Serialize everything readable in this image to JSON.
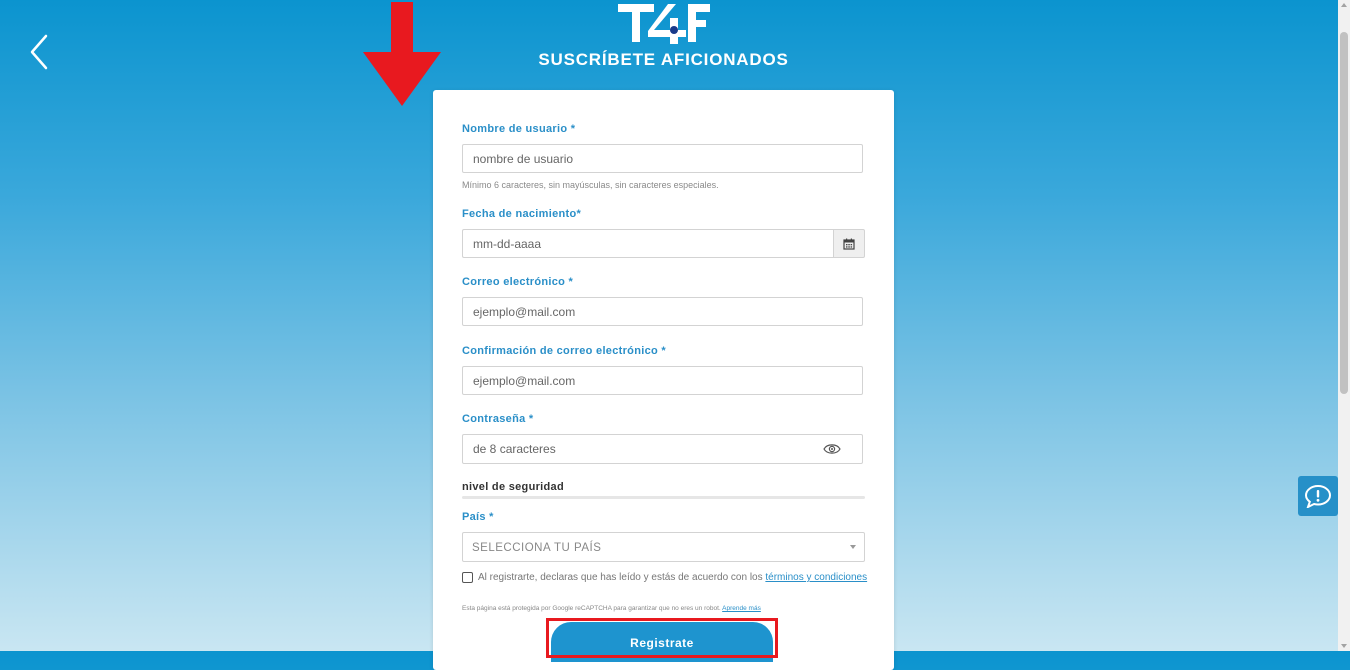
{
  "header": {
    "title": "SUSCRÍBETE AFICIONADOS",
    "logo_text": "T4F"
  },
  "form": {
    "username": {
      "label": "Nombre de usuario *",
      "placeholder": "nombre de usuario",
      "hint": "Mínimo 6 caracteres, sin mayúsculas, sin caracteres especiales."
    },
    "birthdate": {
      "label": "Fecha de nacimiento*",
      "placeholder": "mm-dd-aaaa"
    },
    "email": {
      "label": "Correo electrónico *",
      "placeholder": "ejemplo@mail.com"
    },
    "email_confirm": {
      "label": "Confirmación de correo electrónico *",
      "placeholder": "ejemplo@mail.com"
    },
    "password": {
      "label": "Contraseña *",
      "placeholder": "de 8 caracteres"
    },
    "strength_label": "nivel de seguridad",
    "country": {
      "label": "País *",
      "selected": "SELECCIONA TU PAÍS"
    },
    "terms_text": "Al registrarte, declaras que has leído y estás de acuerdo con los ",
    "terms_link": "términos y condiciones",
    "recaptcha_text": "Esta página está protegida por Google reCAPTCHA para garantizar que no eres un robot. ",
    "recaptcha_link": "Aprende más",
    "submit_label": "Registrate"
  },
  "colors": {
    "accent": "#2a8fc8",
    "button": "#1e94cf",
    "highlight": "#e8191f"
  },
  "icons": [
    "back-chevron-icon",
    "calendar-icon",
    "eye-icon",
    "feedback-icon",
    "down-arrow-icon"
  ]
}
